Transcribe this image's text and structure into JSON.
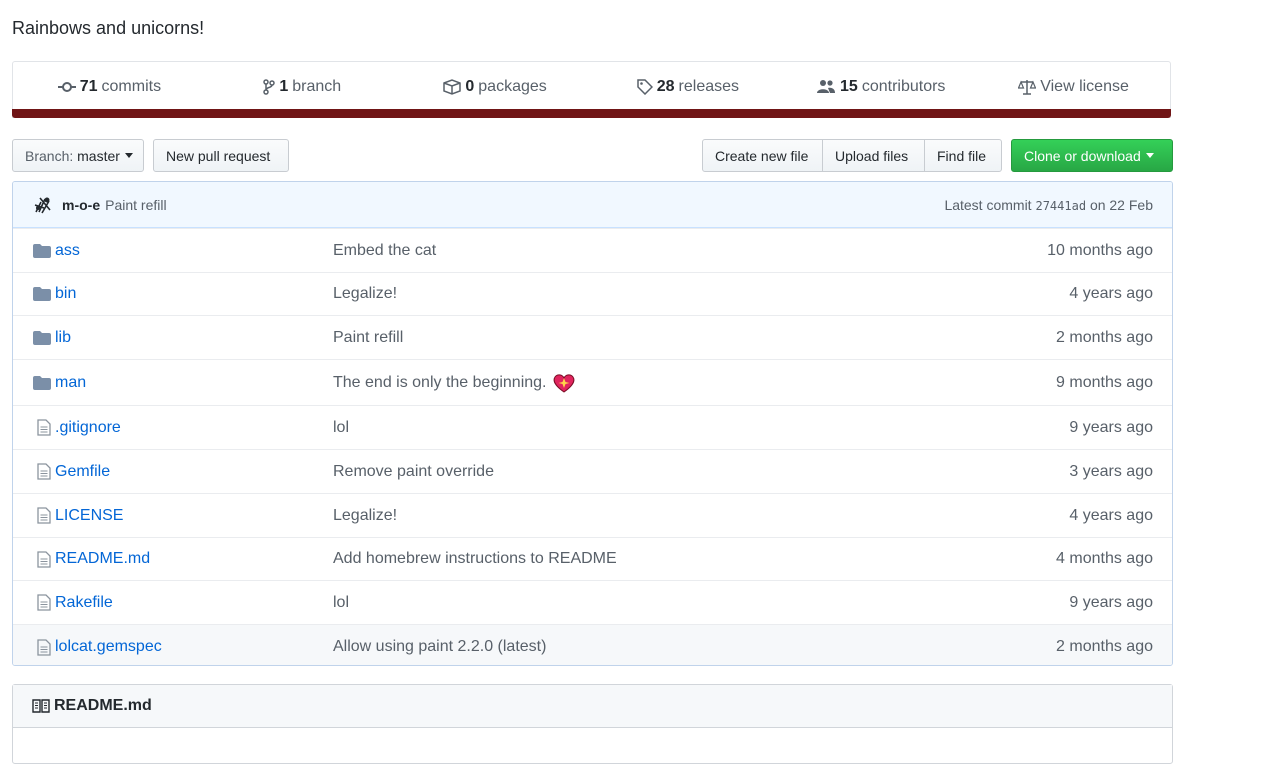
{
  "repo": {
    "description": "Rainbows and unicorns!"
  },
  "summary": {
    "commits": {
      "count": "71",
      "label": "commits",
      "icon": "commit-icon"
    },
    "branches": {
      "count": "1",
      "label": "branch",
      "icon": "branch-icon"
    },
    "packages": {
      "count": "0",
      "label": "packages",
      "icon": "package-icon"
    },
    "releases": {
      "count": "28",
      "label": "releases",
      "icon": "tag-icon"
    },
    "contributors": {
      "count": "15",
      "label": "contributors",
      "icon": "people-icon"
    },
    "license": {
      "label": "View license",
      "icon": "law-icon"
    },
    "language_color": "#701516"
  },
  "toolbar": {
    "branch_prefix": "Branch:",
    "branch_name": "master",
    "new_pull_request": "New pull request",
    "create_new_file": "Create new file",
    "upload_files": "Upload files",
    "find_file": "Find file",
    "clone_or_download": "Clone or download",
    "clone_color": "#28a745"
  },
  "latest_commit": {
    "author": "m-o-e",
    "message": "Paint refill",
    "label": "Latest commit",
    "sha": "27441ad",
    "date": "on 22 Feb"
  },
  "files": [
    {
      "type": "dir",
      "name": "ass",
      "message": "Embed the cat",
      "age": "10 months ago"
    },
    {
      "type": "dir",
      "name": "bin",
      "message": "Legalize!",
      "age": "4 years ago"
    },
    {
      "type": "dir",
      "name": "lib",
      "message": "Paint refill",
      "age": "2 months ago"
    },
    {
      "type": "dir",
      "name": "man",
      "message": "The end is only the beginning.",
      "age": "9 months ago"
    },
    {
      "type": "file",
      "name": ".gitignore",
      "message": "lol",
      "age": "9 years ago"
    },
    {
      "type": "file",
      "name": "Gemfile",
      "message": "Remove paint override",
      "age": "3 years ago"
    },
    {
      "type": "file",
      "name": "LICENSE",
      "message": "Legalize!",
      "age": "4 years ago"
    },
    {
      "type": "file",
      "name": "README.md",
      "message": "Add homebrew instructions to README",
      "age": "4 months ago"
    },
    {
      "type": "file",
      "name": "Rakefile",
      "message": "lol",
      "age": "9 years ago"
    },
    {
      "type": "file",
      "name": "lolcat.gemspec",
      "message": "Allow using paint 2.2.0 (latest)",
      "age": "2 months ago"
    }
  ],
  "readme": {
    "title": "README.md",
    "icon": "book-icon"
  }
}
